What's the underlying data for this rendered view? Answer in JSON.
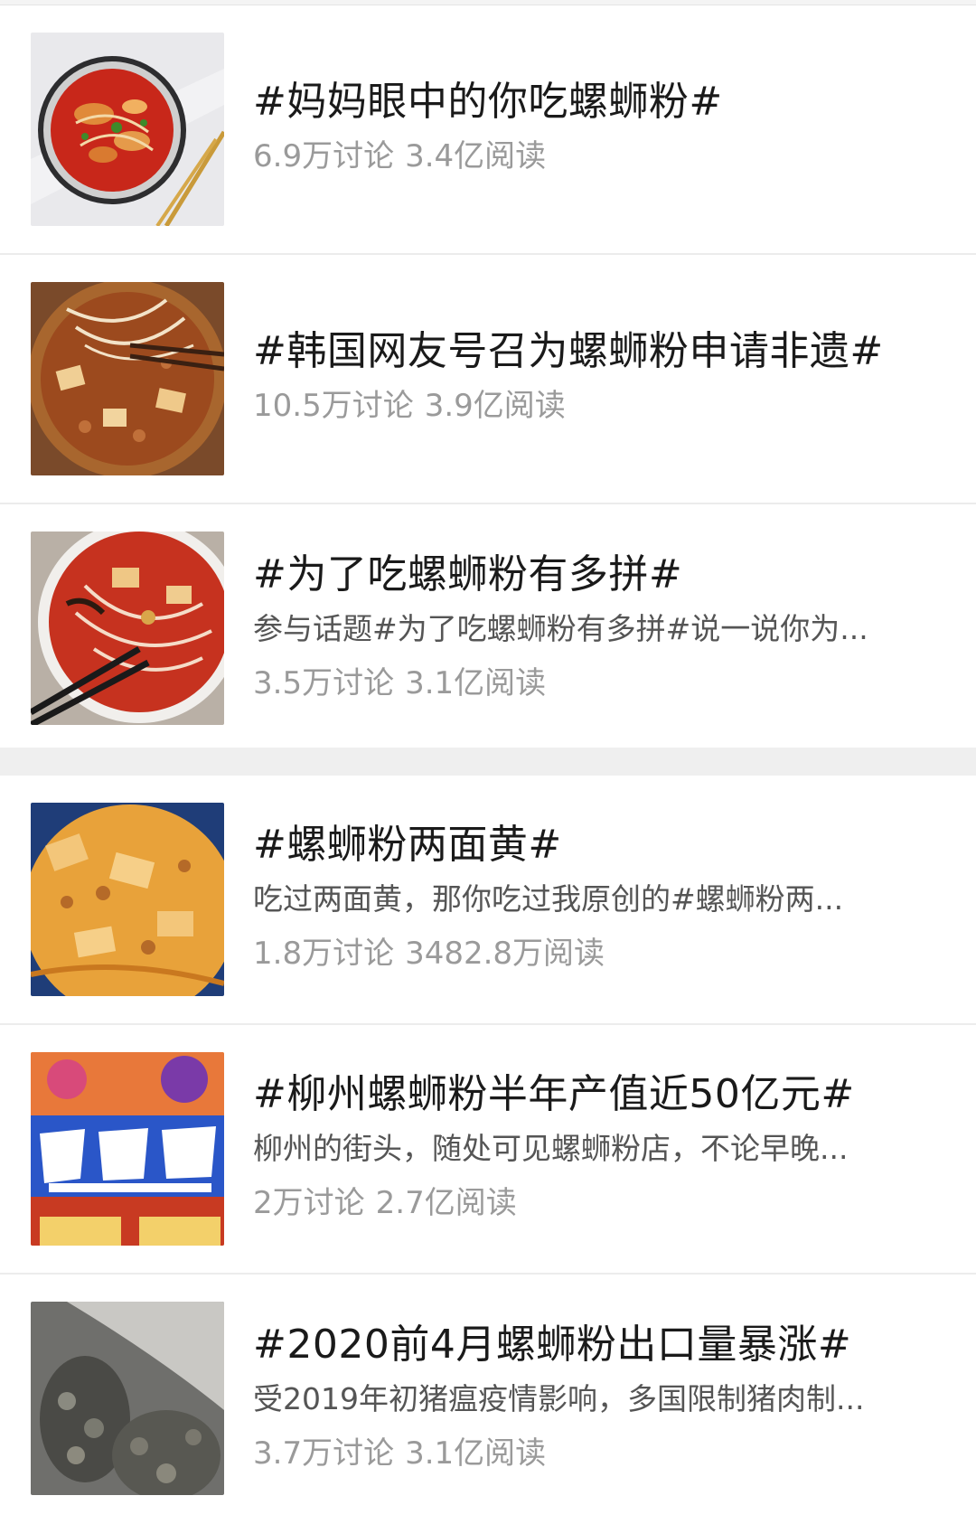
{
  "topics": [
    {
      "title": "#妈妈眼中的你吃螺蛳粉#",
      "desc": "",
      "discussions": "6.9万讨论",
      "reads": "3.4亿阅读",
      "image_icon": "bowl-of-noodles-image"
    },
    {
      "title": "#韩国网友号召为螺蛳粉申请非遗#",
      "desc": "",
      "discussions": "10.5万讨论",
      "reads": "3.9亿阅读",
      "image_icon": "pot-of-noodles-image"
    },
    {
      "title": "#为了吃螺蛳粉有多拼#",
      "desc": "参与话题#为了吃螺蛳粉有多拼#说一说你为...",
      "discussions": "3.5万讨论",
      "reads": "3.1亿阅读",
      "image_icon": "noodle-bowl-chopsticks-image"
    },
    {
      "title": "#螺蛳粉两面黄#",
      "desc": "吃过两面黄，那你吃过我原创的#螺蛳粉两...",
      "discussions": "1.8万讨论",
      "reads": "3482.8万阅读",
      "image_icon": "fried-noodles-plate-image"
    },
    {
      "title": "#柳州螺蛳粉半年产值近50亿元#",
      "desc": "柳州的街头，随处可见螺蛳粉店，不论早晚...",
      "discussions": "2万讨论",
      "reads": "2.7亿阅读",
      "image_icon": "noodle-package-poster-image"
    },
    {
      "title": "#2020前4月螺蛳粉出口量暴涨#",
      "desc": "受2019年初猪瘟疫情影响，多国限制猪肉制...",
      "discussions": "3.7万讨论",
      "reads": "3.1亿阅读",
      "image_icon": "snails-closeup-image"
    }
  ]
}
